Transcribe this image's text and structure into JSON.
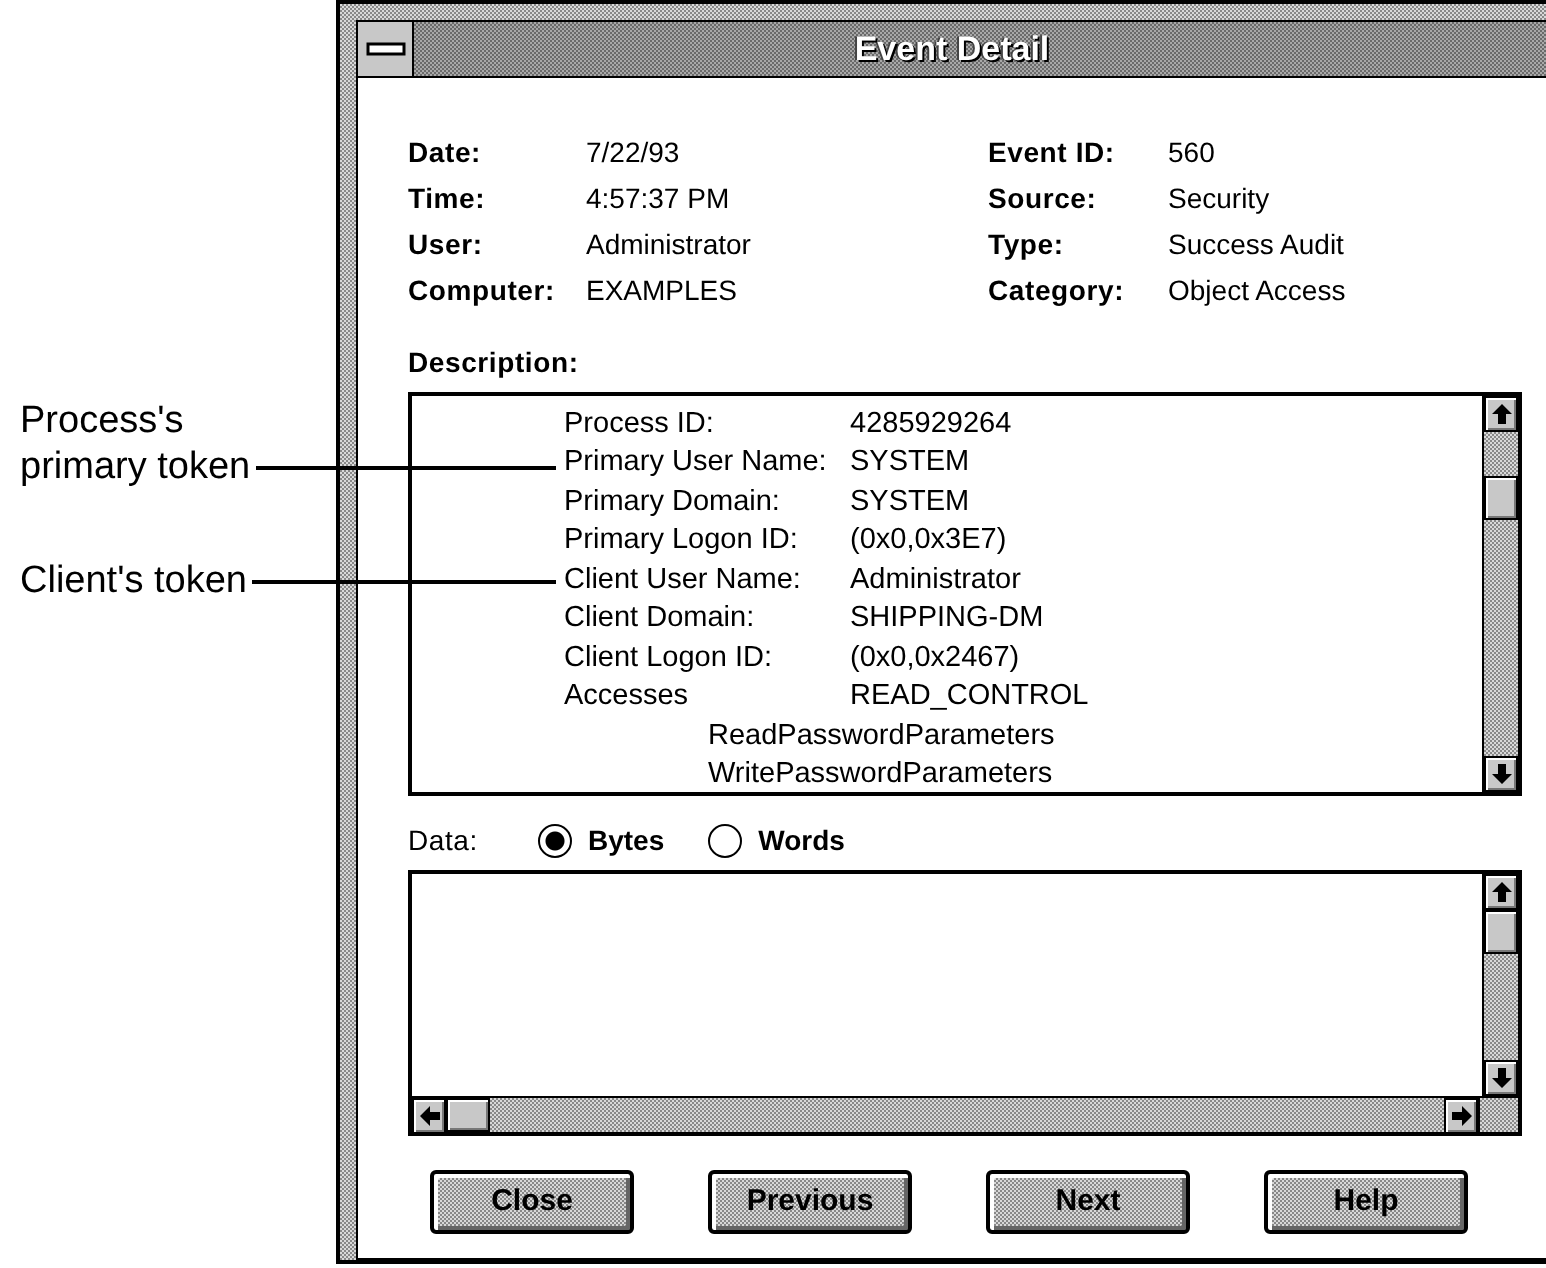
{
  "callouts": [
    {
      "text": "Process's primary token"
    },
    {
      "text": "Client's token"
    }
  ],
  "window": {
    "title": "Event Detail"
  },
  "fields_left": [
    {
      "label": "Date:",
      "value": "7/22/93"
    },
    {
      "label": "Time:",
      "value": "4:57:37 PM"
    },
    {
      "label": "User:",
      "value": "Administrator"
    },
    {
      "label": "Computer:",
      "value": "EXAMPLES"
    }
  ],
  "fields_right": [
    {
      "label": "Event ID:",
      "value": "560"
    },
    {
      "label": "Source:",
      "value": "Security"
    },
    {
      "label": "Type:",
      "value": "Success Audit"
    },
    {
      "label": "Category:",
      "value": "Object Access"
    }
  ],
  "description": {
    "label": "Description:",
    "lines": [
      {
        "kind": "pair",
        "name": "Process ID:",
        "value": "4285929264"
      },
      {
        "kind": "pair",
        "name": "Primary User Name:",
        "value": "SYSTEM"
      },
      {
        "kind": "pair",
        "name": "Primary Domain:",
        "value": "SYSTEM"
      },
      {
        "kind": "pair",
        "name": "Primary Logon ID:",
        "value": "(0x0,0x3E7)"
      },
      {
        "kind": "pair",
        "name": "Client User Name:",
        "value": "Administrator"
      },
      {
        "kind": "pair",
        "name": "Client Domain:",
        "value": "SHIPPING-DM"
      },
      {
        "kind": "pair",
        "name": "Client Logon ID:",
        "value": "(0x0,0x2467)"
      },
      {
        "kind": "pair",
        "name": "Accesses",
        "value": "READ_CONTROL"
      },
      {
        "kind": "continuation",
        "value": "ReadPasswordParameters"
      },
      {
        "kind": "continuation",
        "value": "WritePasswordParameters"
      }
    ]
  },
  "data": {
    "label": "Data:",
    "options": [
      {
        "label": "Bytes",
        "selected": true
      },
      {
        "label": "Words",
        "selected": false
      }
    ]
  },
  "buttons": [
    "Close",
    "Previous",
    "Next",
    "Help"
  ]
}
